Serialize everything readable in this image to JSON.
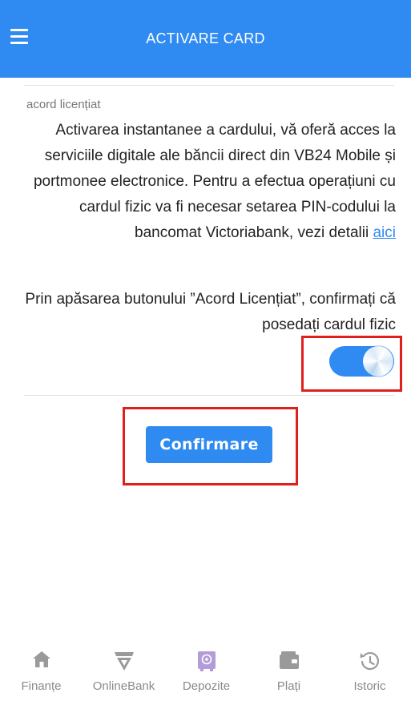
{
  "header": {
    "title": "ACTIVARE CARD"
  },
  "content": {
    "section_label": "acord licențiat",
    "description": "Activarea instantanee a cardului, vă oferă acces la serviciile digitale ale băncii direct din VB24 Mobile și portmonee electronice. Pentru a efectua operațiuni cu cardul fizic va fi necesar setarea PIN-codului la bancomat Victoriabank, vezi detalii",
    "link_text": "aici",
    "notice": "Prin apăsarea butonului ”Acord Licențiat”, confirmați că posedați cardul fizic",
    "toggle_on": true,
    "confirm_label": "Confirmare"
  },
  "tabs": [
    {
      "label": "Finanțe",
      "icon": "home-icon"
    },
    {
      "label": "OnlineBank",
      "icon": "victoriabank-logo-icon"
    },
    {
      "label": "Depozite",
      "icon": "deposit-icon"
    },
    {
      "label": "Plați",
      "icon": "wallet-icon"
    },
    {
      "label": "Istoric",
      "icon": "history-icon"
    }
  ],
  "colors": {
    "accent": "#2f8af2",
    "highlight": "#e0201c",
    "tab_icon": "#9a9a9a",
    "deposit_icon": "#b49cd9"
  }
}
